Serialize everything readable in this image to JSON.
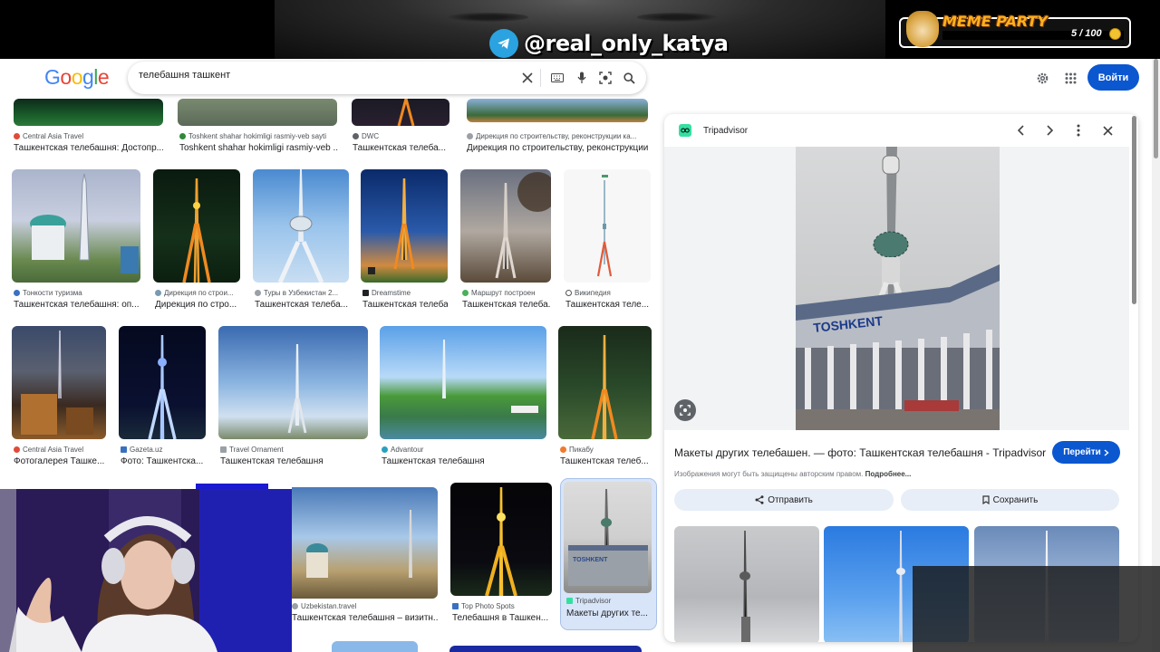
{
  "overlay": {
    "telegram_handle": "@real_only_katya",
    "meme_party_title": "MEME PARTY",
    "meme_party_count": "5 / 100"
  },
  "header": {
    "logo_letters": [
      "G",
      "o",
      "o",
      "g",
      "l",
      "e"
    ],
    "search_value": "телебашня ташкент",
    "signin_label": "Войти"
  },
  "grid": {
    "row0": [
      {
        "source": "Central Asia Travel",
        "caption": "Ташкентская телебашня: Достопр..."
      },
      {
        "source": "Toshkent shahar hokimligi rasmiy-veb sayti",
        "caption": "Toshkent shahar hokimligi rasmiy-veb ..."
      },
      {
        "source": "DWC",
        "caption": "Ташкентская телеба..."
      },
      {
        "source": "Дирекция по строительству, реконструкции ка...",
        "caption": "Дирекция по строительству, реконструкции ..."
      }
    ],
    "row1": [
      {
        "source": "Тонкости туризма",
        "caption": "Ташкентская телебашня: оп..."
      },
      {
        "source": "Дирекция по строи...",
        "caption": "Дирекция по стро..."
      },
      {
        "source": "Туры в Узбекистан 2...",
        "caption": "Ташкентская телеба..."
      },
      {
        "source": "Dreamstime",
        "caption": "Ташкентская телеба..."
      },
      {
        "source": "Маршрут построен",
        "caption": "Ташкентская телеба..."
      },
      {
        "source": "Википедия",
        "caption": "Ташкентская теле..."
      }
    ],
    "row2": [
      {
        "source": "Central Asia Travel",
        "caption": "Фотогалерея Ташке..."
      },
      {
        "source": "Gazeta.uz",
        "caption": "Фото: Ташкентска..."
      },
      {
        "source": "Travel Ornament",
        "caption": "Ташкентская телебашня"
      },
      {
        "source": "Advantour",
        "caption": "Ташкентская телебашня"
      },
      {
        "source": "Пикабу",
        "caption": "Ташкентская телеб..."
      }
    ],
    "row3": [
      {
        "source": "Uzbekistan.travel",
        "caption": "Ташкентская телебашня – визитн..."
      },
      {
        "source": "Top Photo Spots",
        "caption": "Телебашня в Ташкен..."
      },
      {
        "source": "Tripadvisor",
        "caption": "Макеты других те..."
      }
    ]
  },
  "panel": {
    "source": "Tripadvisor",
    "building_sign": "TOSHKENT",
    "title": "Макеты других телебашен. — фото: Ташкентская телебашня - Tripadvisor",
    "goto_label": "Перейти",
    "copyright": "Изображения могут быть защищены авторским правом.",
    "copyright_more": "Подробнее...",
    "share_label": "Отправить",
    "save_label": "Сохранить"
  }
}
